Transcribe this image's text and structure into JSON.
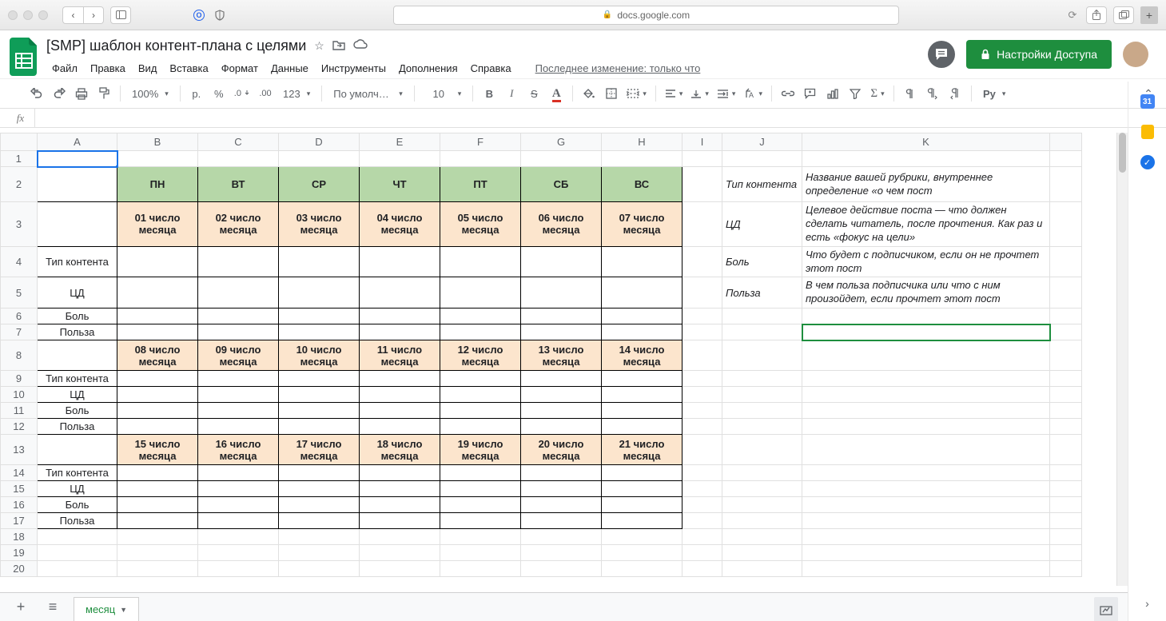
{
  "browser": {
    "url": "docs.google.com"
  },
  "doc": {
    "title": "[SMP] шаблон контент-плана с целями",
    "last_edit": "Последнее изменение: только что"
  },
  "menus": [
    "Файл",
    "Правка",
    "Вид",
    "Вставка",
    "Формат",
    "Данные",
    "Инструменты",
    "Дополнения",
    "Справка"
  ],
  "share_label": "Настройки Доступа",
  "toolbar": {
    "zoom": "100%",
    "currency": "р.",
    "percent": "%",
    "dec_dec": ".0",
    "dec_inc": ".00",
    "num_fmt": "123",
    "font": "По умолча...",
    "font_size": "10",
    "py": "Py"
  },
  "columns": [
    "A",
    "B",
    "C",
    "D",
    "E",
    "F",
    "G",
    "H",
    "I",
    "J",
    "K"
  ],
  "plan": {
    "days": [
      "ПН",
      "ВТ",
      "СР",
      "ЧТ",
      "ПТ",
      "СБ",
      "ВС"
    ],
    "week1": [
      "01 число месяца",
      "02 число месяца",
      "03 число месяца",
      "04 число месяца",
      "05 число месяца",
      "06 число месяца",
      "07 число месяца"
    ],
    "week2": [
      "08 число месяца",
      "09 число месяца",
      "10 число месяца",
      "11 число месяца",
      "12 число месяца",
      "13 число месяца",
      "14 число месяца"
    ],
    "week3": [
      "15 число месяца",
      "16 число месяца",
      "17 число месяца",
      "18 число месяца",
      "19 число месяца",
      "20 число месяца",
      "21 число месяца"
    ],
    "labels": {
      "tip": "Тип контента",
      "cd": "ЦД",
      "bol": "Боль",
      "polza": "Польза"
    }
  },
  "notes": {
    "j": [
      "Тип контента",
      "ЦД",
      "Боль",
      "Польза"
    ],
    "k": [
      "Название вашей рубрики, внутреннее определение «о чем пост",
      "Целевое действие поста — что должен сделать читатель, после прочтения. Как раз и есть «фокус на цели»",
      "Что будет с подписчиком, если он не прочтет этот пост",
      "В чем польза подписчика или что с ним произойдет, если прочтет этот пост"
    ]
  },
  "sheet_tab": "месяц"
}
